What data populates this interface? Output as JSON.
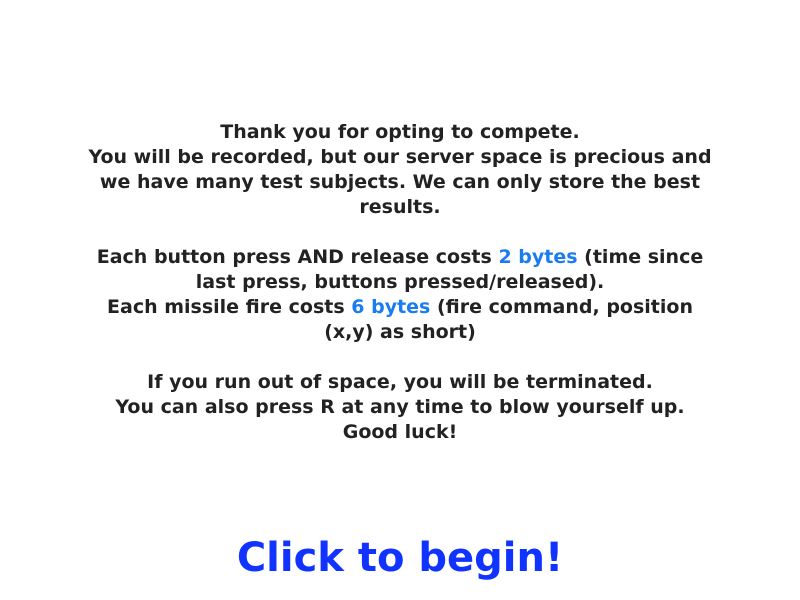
{
  "intro": {
    "thanks": [
      "Thank you for opting to compete.",
      "You will be recorded, but our server space is precious and we have many test subjects. We can only store the best results."
    ],
    "costs": {
      "press_prefix": "Each button press AND release costs ",
      "press_cost": "2 bytes",
      "press_suffix": " (time since last press, buttons pressed/released).",
      "missile_prefix": "Each missile fire costs ",
      "missile_cost": "6 bytes",
      "missile_suffix": " (fire command, position (x,y) as short)"
    },
    "warnings": [
      "If you run out of space, you will be terminated.",
      "You can also press R at any time to blow yourself up.",
      "Good luck!"
    ]
  },
  "begin_label": "Click to begin!",
  "colors": {
    "text": "#222222",
    "highlight": "#1a7cf0",
    "begin": "#1133ff",
    "background": "#ffffff"
  }
}
